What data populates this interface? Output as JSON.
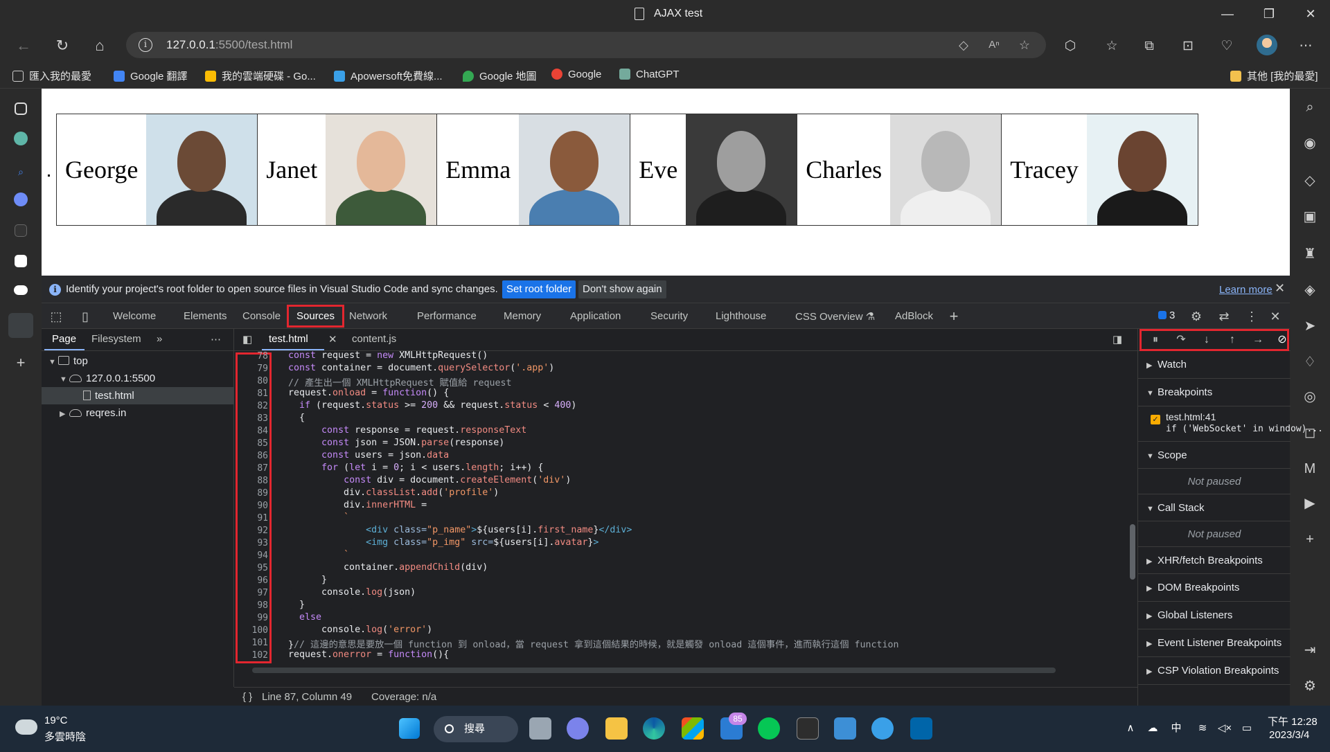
{
  "window": {
    "title": "AJAX test",
    "minimize": "—",
    "restore": "❐",
    "close": "✕"
  },
  "address": {
    "url_host": "127.0.0.1",
    "url_rest": ":5500/test.html"
  },
  "bookmarks": [
    {
      "label": "匯入我的最愛",
      "color": "#cfcfcf"
    },
    {
      "label": "Google 翻譯",
      "color": "#4285f4"
    },
    {
      "label": "我的雲端硬碟 - Go...",
      "color": "#fbbc04"
    },
    {
      "label": "Apowersoft免費線...",
      "color": "#3aa0e8"
    },
    {
      "label": "Google 地圖",
      "color": "#34a853"
    },
    {
      "label": "Google",
      "color": "#ea4335"
    },
    {
      "label": "ChatGPT",
      "color": "#74aa9c"
    },
    {
      "label": "其他 [我的最愛]",
      "color": "#f2c14e"
    }
  ],
  "profiles": [
    {
      "name": "George",
      "skin": "#6b4a36",
      "bg": "#cfe0ea",
      "shirt": "#2a2a2a"
    },
    {
      "name": "Janet",
      "skin": "#e4b899",
      "bg": "#e6e1da",
      "shirt": "#3d5a3a"
    },
    {
      "name": "Emma",
      "skin": "#8a5a3c",
      "bg": "#d8dee3",
      "shirt": "#4a7eb0"
    },
    {
      "name": "Eve",
      "skin": "#9e9e9e",
      "bg": "#3a3a3a",
      "shirt": "#1e1e1e"
    },
    {
      "name": "Charles",
      "skin": "#b8b8b8",
      "bg": "#dcdcdc",
      "shirt": "#efefef"
    },
    {
      "name": "Tracey",
      "skin": "#6a4431",
      "bg": "#e7f1f4",
      "shirt": "#1a1a1a"
    }
  ],
  "devtools": {
    "infobar": {
      "message": "Identify your project's root folder to open source files in Visual Studio Code and sync changes.",
      "set_root": "Set root folder",
      "dont_show": "Don't show again",
      "learn_more": "Learn more"
    },
    "tabs": [
      "Welcome",
      "Elements",
      "Console",
      "Sources",
      "Network",
      "Performance",
      "Memory",
      "Application",
      "Security",
      "Lighthouse",
      "CSS Overview ⚗",
      "AdBlock"
    ],
    "issue_count": "3",
    "navigator": {
      "tab_page": "Page",
      "tab_filesystem": "Filesystem",
      "tree": [
        "top",
        "127.0.0.1:5500",
        "test.html",
        "reqres.in"
      ]
    },
    "editor": {
      "tab_active": "test.html",
      "tab_other": "content.js"
    },
    "code": {
      "line_numbers": [
        "78",
        "79",
        "80",
        "81",
        "82",
        "83",
        "84",
        "85",
        "86",
        "87",
        "88",
        "89",
        "90",
        "91",
        "92",
        "93",
        "94",
        "95",
        "96",
        "97",
        "98",
        "99",
        "100",
        "101",
        "102"
      ]
    },
    "status": {
      "braces": "{ }",
      "position": "Line 87, Column 49",
      "coverage": "Coverage: n/a"
    },
    "debugger": {
      "watch": "Watch",
      "breakpoints": "Breakpoints",
      "bp_file": "test.html:41",
      "bp_code": "if ('WebSocket' in window)...",
      "scope": "Scope",
      "not_paused": "Not paused",
      "call_stack": "Call Stack",
      "xhr": "XHR/fetch Breakpoints",
      "dom": "DOM Breakpoints",
      "global": "Global Listeners",
      "event": "Event Listener Breakpoints",
      "csp": "CSP Violation Breakpoints"
    }
  },
  "taskbar": {
    "temp": "19°C",
    "weather": "多雲時陰",
    "search": "搜尋",
    "mail_badge": "85",
    "ime": "中",
    "time": "下午 12:28",
    "date": "2023/3/4"
  }
}
